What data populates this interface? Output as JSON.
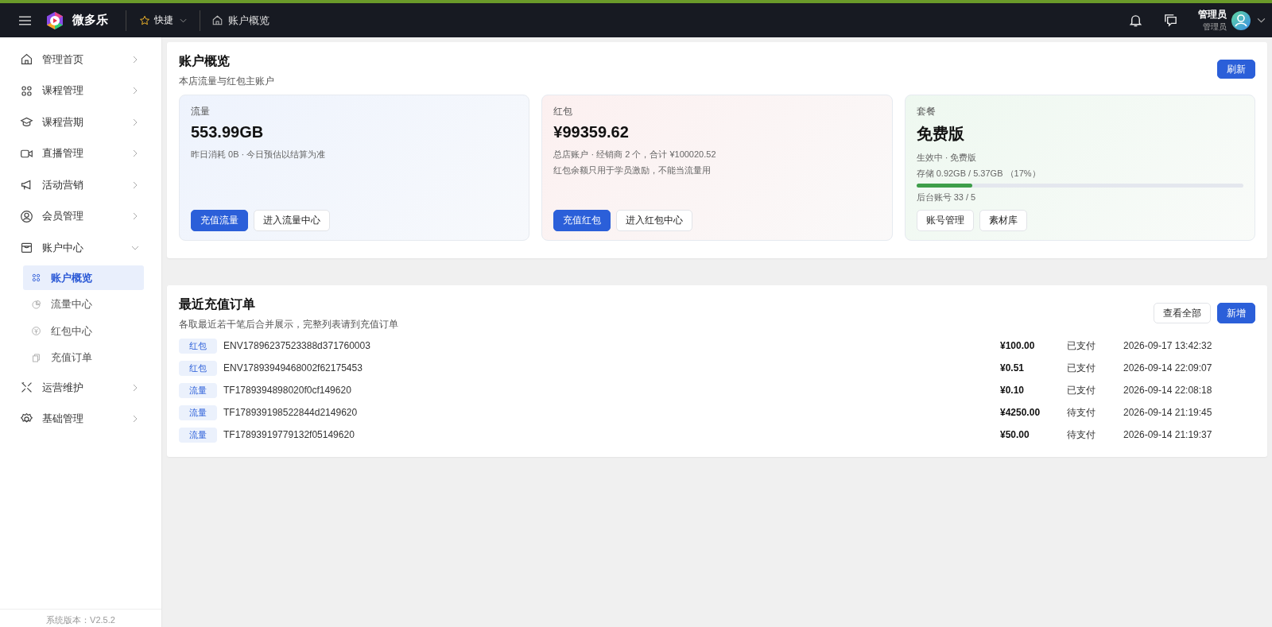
{
  "topbar": {
    "brand": "微多乐",
    "quick": "快捷",
    "breadcrumb": "账户概览",
    "user_name": "管理员",
    "user_role": "管理员"
  },
  "sidebar": {
    "items": [
      {
        "label": "管理首页",
        "expanded": false
      },
      {
        "label": "课程管理",
        "expanded": false
      },
      {
        "label": "课程营期",
        "expanded": false
      },
      {
        "label": "直播管理",
        "expanded": false
      },
      {
        "label": "活动营销",
        "expanded": false
      },
      {
        "label": "会员管理",
        "expanded": false
      },
      {
        "label": "账户中心",
        "expanded": true,
        "children": [
          {
            "label": "账户概览",
            "selected": true
          },
          {
            "label": "流量中心",
            "selected": false
          },
          {
            "label": "红包中心",
            "selected": false
          },
          {
            "label": "充值订单",
            "selected": false
          }
        ]
      },
      {
        "label": "运营维护",
        "expanded": false
      },
      {
        "label": "基础管理",
        "expanded": false
      }
    ],
    "version": "系统版本：V2.5.2"
  },
  "overview": {
    "title": "账户概览",
    "subtitle": "本店流量与红包主账户",
    "refresh": "刷新",
    "cards": [
      {
        "kind": "flow",
        "label": "流量",
        "value": "553.99GB",
        "lines": [
          "昨日消耗 0B · 今日预估以结算为准"
        ],
        "buttons": [
          {
            "label": "充值流量",
            "primary": true
          },
          {
            "label": "进入流量中心",
            "primary": false
          }
        ]
      },
      {
        "kind": "redpacket",
        "label": "红包",
        "value": "¥99359.62",
        "lines": [
          "总店账户 · 经销商 2 个，合计 ¥100020.52",
          "红包余额只用于学员激励，不能当流量用"
        ],
        "buttons": [
          {
            "label": "充值红包",
            "primary": true
          },
          {
            "label": "进入红包中心",
            "primary": false
          }
        ]
      },
      {
        "kind": "plan",
        "label": "套餐",
        "value": "免费版",
        "lines": [
          "生效中 · 免费版",
          "存储 0.92GB / 5.37GB （17%）"
        ],
        "storage": {
          "level": 0.17
        },
        "accounts": "后台账号 33 / 5",
        "buttons": [
          {
            "label": "账号管理",
            "primary": false
          },
          {
            "label": "素材库",
            "primary": false
          }
        ]
      }
    ]
  },
  "orders": {
    "title": "最近充值订单",
    "subtitle": "各取最近若干笔后合并展示，完整列表请到充值订单",
    "view_all": "查看全部",
    "add": "新增",
    "rows": [
      {
        "tag": "红包",
        "id": "ENV17896237523388d371760003",
        "amount": "¥100.00",
        "status": "已支付",
        "time": "2026-09-17 13:42:32"
      },
      {
        "tag": "红包",
        "id": "ENV17893949468002f62175453",
        "amount": "¥0.51",
        "status": "已支付",
        "time": "2026-09-14 22:09:07"
      },
      {
        "tag": "流量",
        "id": "TF1789394898020f0cf149620",
        "amount": "¥0.10",
        "status": "已支付",
        "time": "2026-09-14 22:08:18"
      },
      {
        "tag": "流量",
        "id": "TF178939198522844d2149620",
        "amount": "¥4250.00",
        "status": "待支付",
        "time": "2026-09-14 21:19:45"
      },
      {
        "tag": "流量",
        "id": "TF17893919779132f05149620",
        "amount": "¥50.00",
        "status": "待支付",
        "time": "2026-09-14 21:19:37"
      }
    ]
  }
}
